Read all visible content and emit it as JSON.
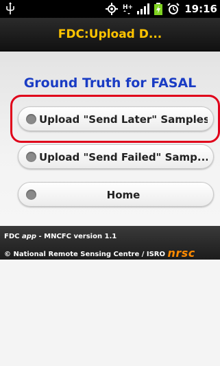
{
  "status_bar": {
    "time": "19:16",
    "icons": [
      "usb-icon",
      "gps-icon",
      "hplus-data-icon",
      "signal-icon",
      "battery-charging-icon",
      "alarm-icon"
    ],
    "network_label": "H+"
  },
  "title_bar": {
    "title": "FDC:Upload D..."
  },
  "main": {
    "heading": "Ground Truth for FASAL",
    "buttons": [
      {
        "label": "Upload \"Send Later\" Samples",
        "highlighted": true
      },
      {
        "label": "Upload \"Send Failed\" Samp..."
      },
      {
        "label": "Home"
      }
    ]
  },
  "footer": {
    "line1_prefix": "FDC ",
    "line1_app": "app",
    "line1_suffix": " - MNCFC version 1.1",
    "line2": "© National Remote Sensing Centre / ISRO ",
    "logo": "nrsc"
  },
  "colors": {
    "title": "#ffc400",
    "heading": "#1a3cc4",
    "highlight": "#e0001a",
    "logo": "#ff8a00"
  }
}
